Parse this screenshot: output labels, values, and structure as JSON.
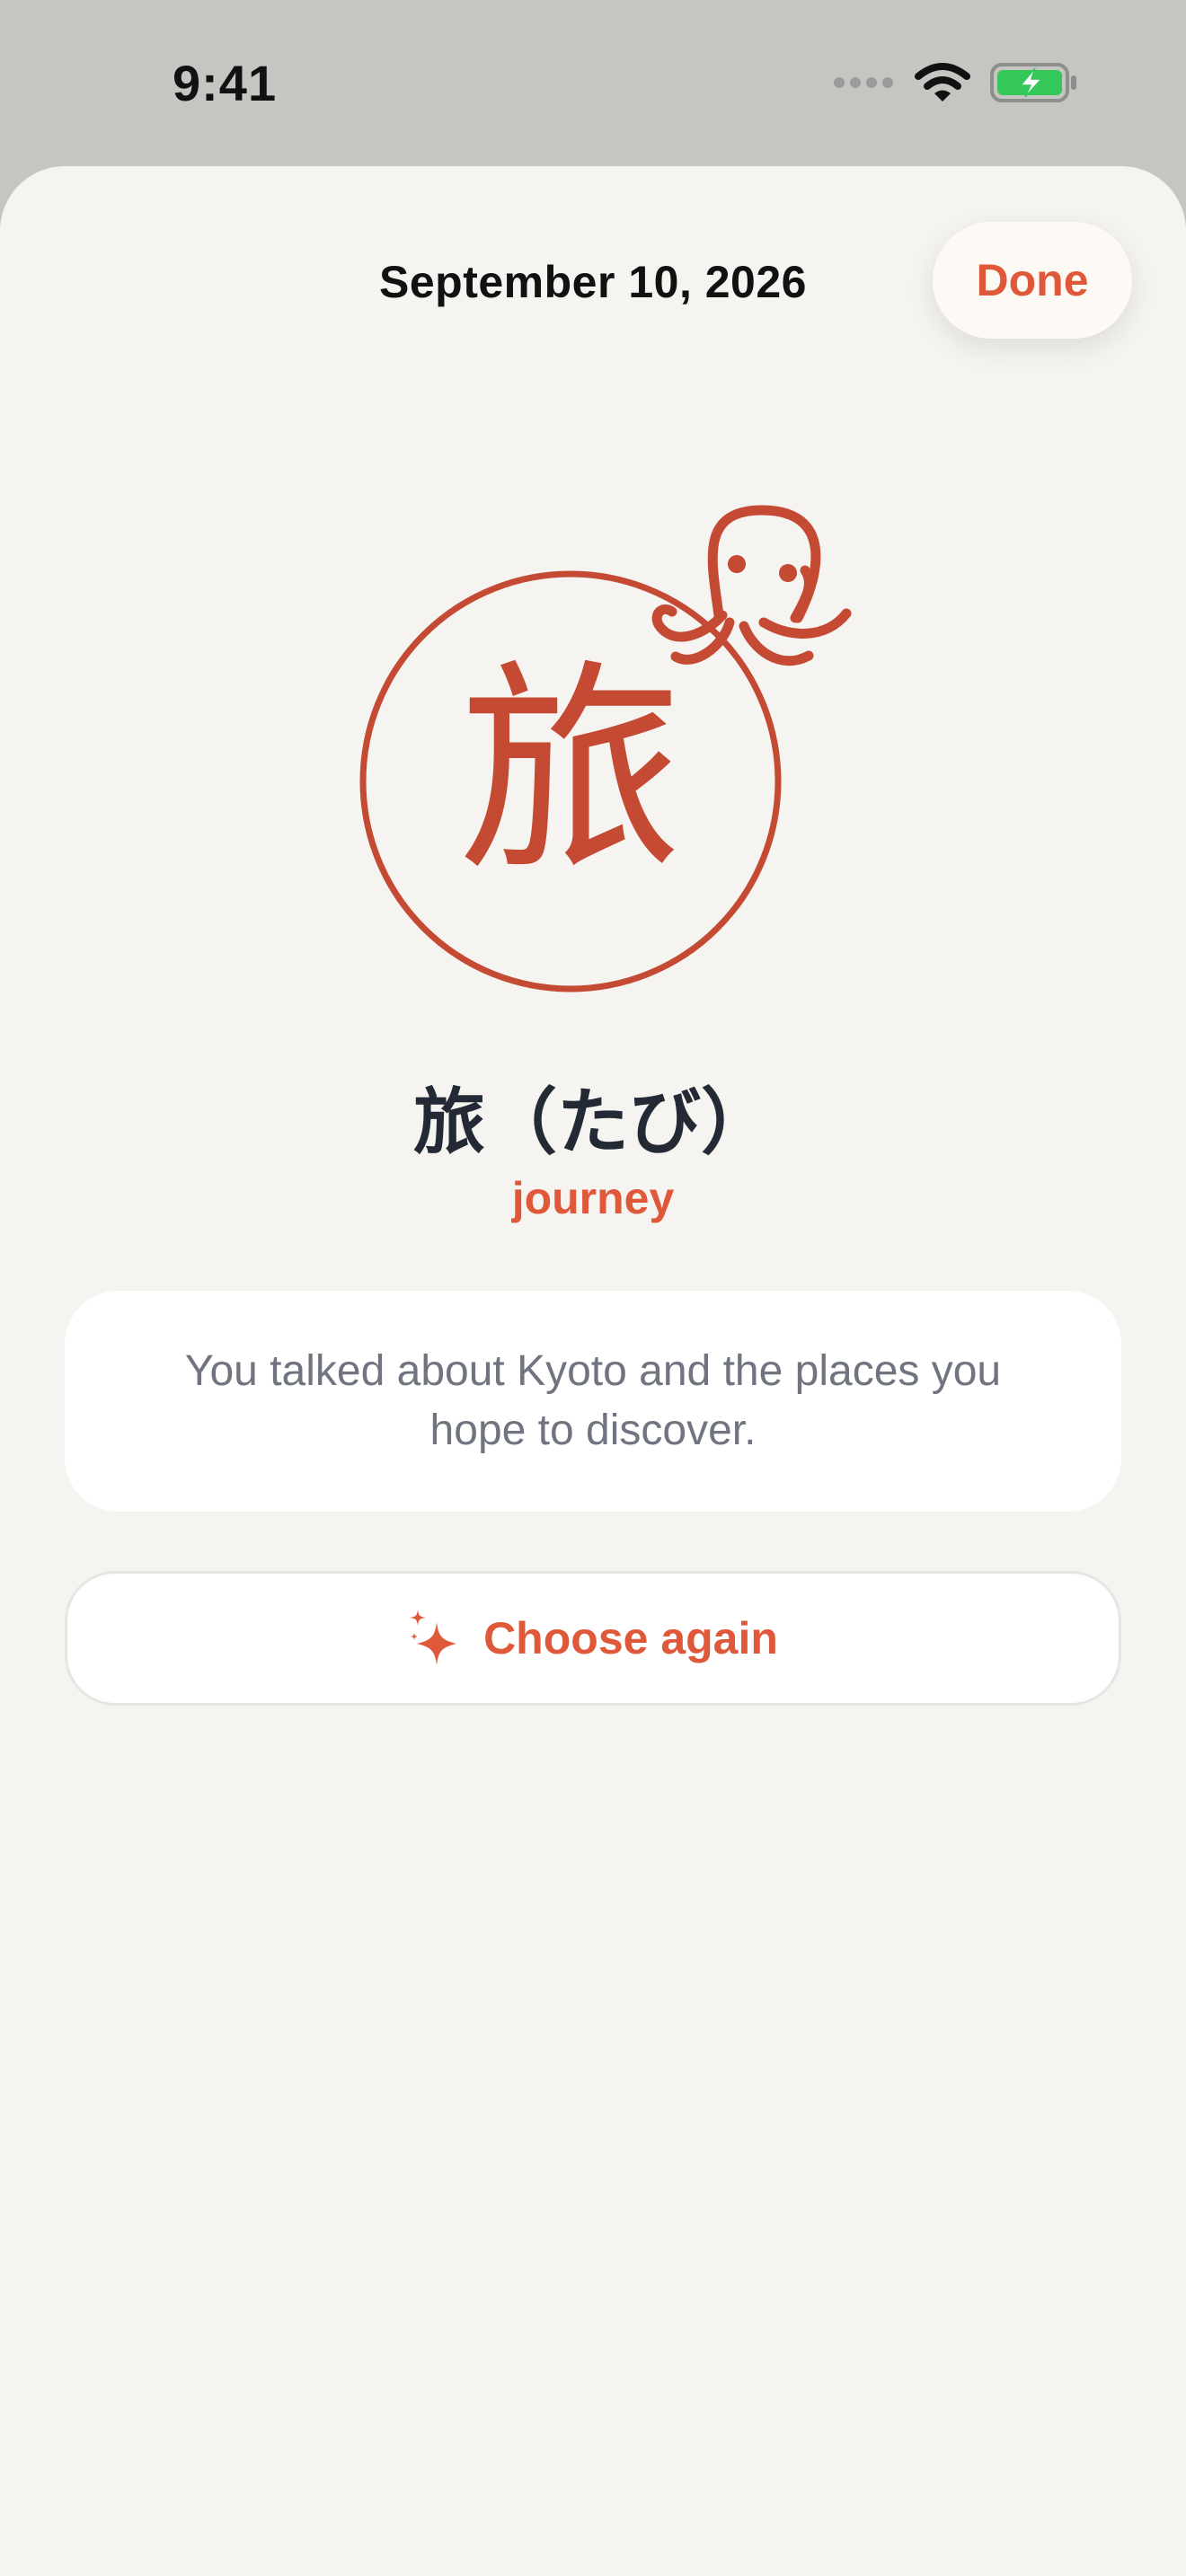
{
  "status_bar": {
    "time": "9:41"
  },
  "header": {
    "date": "September 10, 2026",
    "done_label": "Done"
  },
  "stamp": {
    "kanji": "旅",
    "icon": "octopus-icon",
    "color": "#c44a33"
  },
  "word": {
    "title": "旅（たび）",
    "meaning": "journey"
  },
  "note": {
    "text": "You talked about Kyoto and the places you hope to discover."
  },
  "actions": {
    "choose_again_label": "Choose again",
    "choose_again_icon": "sparkles-icon"
  },
  "colors": {
    "accent": "#e0583a",
    "stamp_red": "#c44a33",
    "sheet_background": "#f6f4f0",
    "title_text": "#232a36",
    "body_text": "#6f7480",
    "battery_green": "#34c759"
  }
}
